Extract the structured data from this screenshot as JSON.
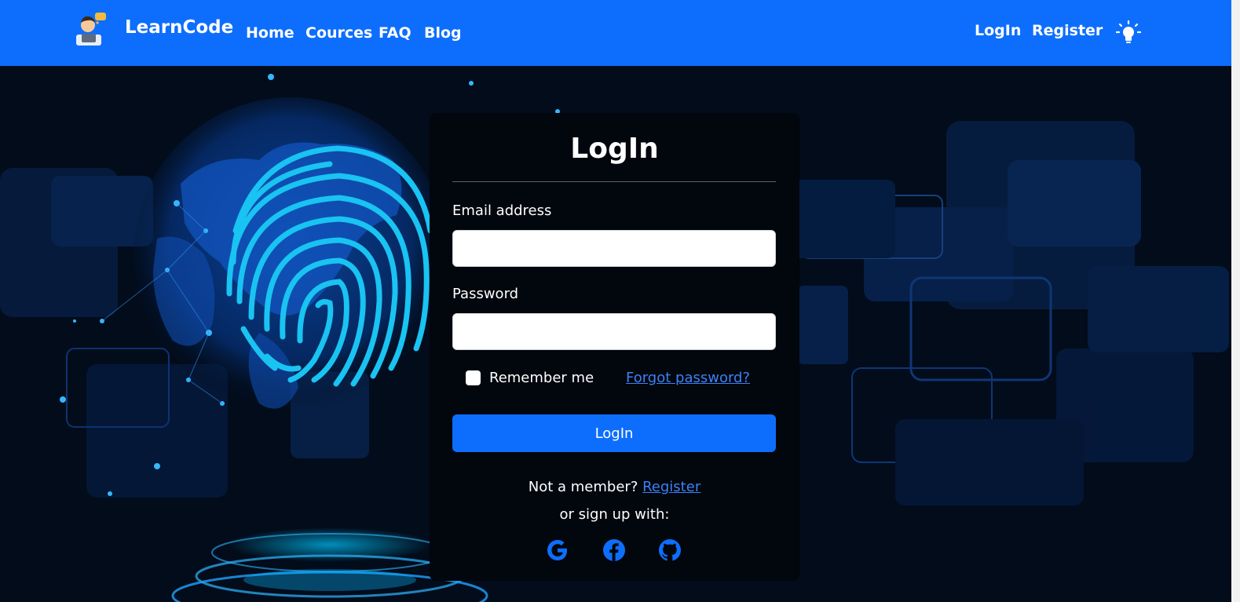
{
  "navbar": {
    "brand": "LearnCode",
    "links": [
      "Home",
      "Cources",
      "FAQ",
      "Blog"
    ],
    "auth_links": [
      "LogIn",
      "Register"
    ],
    "theme_toggle_icon": "lightbulb-icon",
    "background_color": "#0d6efd"
  },
  "login_card": {
    "title": "LogIn",
    "email_label": "Email address",
    "email_value": "",
    "password_label": "Password",
    "password_value": "",
    "remember_label": "Remember me",
    "forgot_link": "Forgot password?",
    "submit_label": "LogIn",
    "not_member_text": "Not a member?",
    "register_link": "Register",
    "signup_text": "or sign up with:",
    "social_icons": [
      "google-icon",
      "facebook-icon",
      "github-icon"
    ]
  },
  "colors": {
    "accent": "#0d6efd",
    "link": "#3b82f6",
    "card_bg": "#02060d",
    "hero_bg": "#020c1b"
  }
}
